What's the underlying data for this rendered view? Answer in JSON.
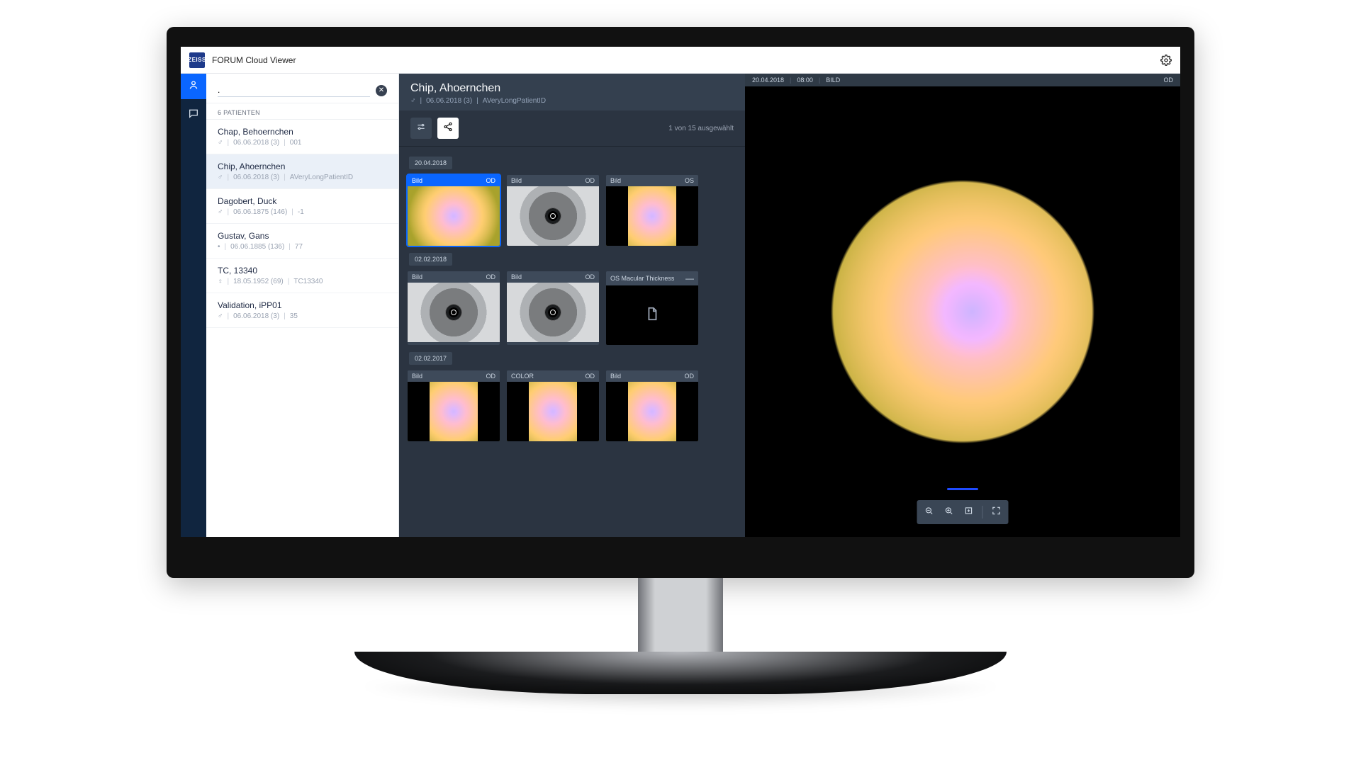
{
  "app": {
    "logo_text": "ZEISS",
    "title": "FORUM Cloud Viewer"
  },
  "rail": {
    "patients_icon": "person-icon",
    "messages_icon": "chat-icon"
  },
  "sidebar": {
    "search_value": ".",
    "list_header": "6 PATIENTEN",
    "patients": [
      {
        "name": "Chap, Behoernchen",
        "sex": "♂",
        "dob": "06.06.2018 (3)",
        "pid": "001",
        "selected": false
      },
      {
        "name": "Chip, Ahoernchen",
        "sex": "♂",
        "dob": "06.06.2018 (3)",
        "pid": "AVeryLongPatientID",
        "selected": true
      },
      {
        "name": "Dagobert, Duck",
        "sex": "♂",
        "dob": "06.06.1875 (146)",
        "pid": "-1",
        "selected": false
      },
      {
        "name": "Gustav, Gans",
        "sex": "•",
        "dob": "06.06.1885 (136)",
        "pid": "77",
        "selected": false
      },
      {
        "name": "TC, 13340",
        "sex": "♀",
        "dob": "18.05.1952 (69)",
        "pid": "TC13340",
        "selected": false
      },
      {
        "name": "Validation, iPP01",
        "sex": "♂",
        "dob": "06.06.2018 (3)",
        "pid": "35",
        "selected": false
      }
    ]
  },
  "mid": {
    "title": "Chip, Ahoernchen",
    "sex": "♂",
    "dob": "06.06.2018 (3)",
    "pid": "AVeryLongPatientID",
    "selection_label": "1 von 15 ausgewählt",
    "groups": [
      {
        "date": "20.04.2018",
        "thumbs": [
          {
            "label": "Bild",
            "eye": "OD",
            "kind": "fundus",
            "selected": true
          },
          {
            "label": "Bild",
            "eye": "OD",
            "kind": "iris",
            "selected": false
          },
          {
            "label": "Bild",
            "eye": "OS",
            "kind": "fundus-cropped",
            "selected": false
          }
        ]
      },
      {
        "date": "02.02.2018",
        "thumbs": [
          {
            "label": "Bild",
            "eye": "OD",
            "kind": "iris",
            "selected": false
          },
          {
            "label": "Bild",
            "eye": "OD",
            "kind": "iris",
            "selected": false
          },
          {
            "label": "OS Macular Thickness",
            "eye": "—",
            "kind": "doc",
            "selected": false
          }
        ]
      },
      {
        "date": "02.02.2017",
        "thumbs": [
          {
            "label": "Bild",
            "eye": "OD",
            "kind": "fundus-cropped",
            "selected": false
          },
          {
            "label": "COLOR",
            "eye": "OD",
            "kind": "fundus-cropped",
            "selected": false
          },
          {
            "label": "Bild",
            "eye": "OD",
            "kind": "fundus-cropped",
            "selected": false
          }
        ]
      }
    ]
  },
  "viewer": {
    "date": "20.04.2018",
    "time": "08:00",
    "type": "BILD",
    "eye": "OD"
  }
}
